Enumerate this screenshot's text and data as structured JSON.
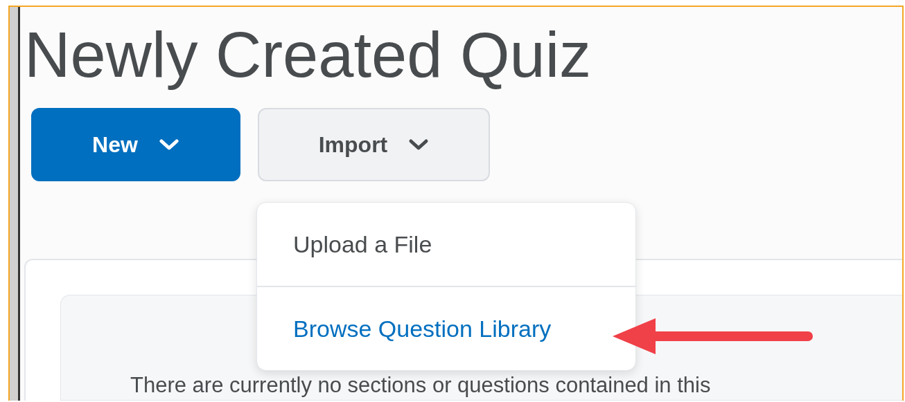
{
  "title": "Newly Created Quiz",
  "buttons": [
    {
      "label": "New",
      "kind": "primary"
    },
    {
      "label": "Import",
      "kind": "secondary"
    }
  ],
  "import_menu": {
    "items": [
      {
        "label": "Upload a File",
        "kind": "plain"
      },
      {
        "label": "Browse Question Library",
        "kind": "link"
      }
    ]
  },
  "empty_message": "There are currently no sections or questions contained in this"
}
